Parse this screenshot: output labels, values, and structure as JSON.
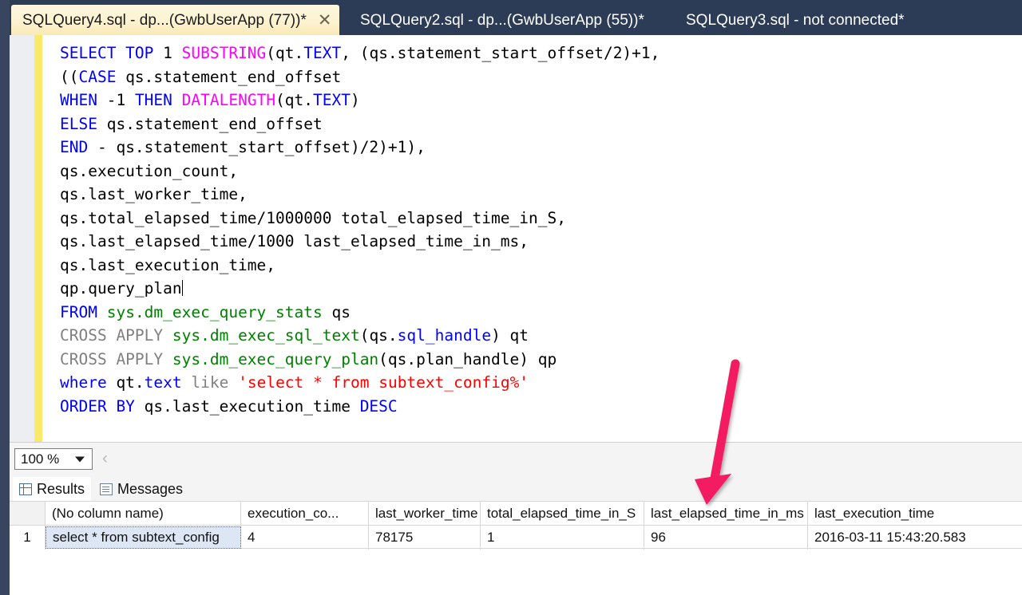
{
  "tabs": [
    {
      "label": "SQLQuery4.sql - dp...(GwbUserApp (77))*",
      "active": true,
      "close_glyph": "✕"
    },
    {
      "label": "SQLQuery2.sql - dp...(GwbUserApp (55))*",
      "active": false
    },
    {
      "label": "SQLQuery3.sql - not connected*",
      "active": false
    }
  ],
  "editor": {
    "lines": [
      [
        {
          "t": "SELECT TOP ",
          "c": "k"
        },
        {
          "t": "1 ",
          "c": ""
        },
        {
          "t": "SUBSTRING",
          "c": "fn"
        },
        {
          "t": "(qt.",
          "c": ""
        },
        {
          "t": "TEXT",
          "c": "k"
        },
        {
          "t": ", (qs.statement_start_offset/2)+1,",
          "c": ""
        }
      ],
      [
        {
          "t": "((",
          "c": ""
        },
        {
          "t": "CASE",
          "c": "k"
        },
        {
          "t": " qs.statement_end_offset",
          "c": ""
        }
      ],
      [
        {
          "t": "WHEN",
          "c": "k"
        },
        {
          "t": " -1 ",
          "c": ""
        },
        {
          "t": "THEN",
          "c": "k"
        },
        {
          "t": " ",
          "c": ""
        },
        {
          "t": "DATALENGTH",
          "c": "fn"
        },
        {
          "t": "(qt.",
          "c": ""
        },
        {
          "t": "TEXT",
          "c": "k"
        },
        {
          "t": ")",
          "c": ""
        }
      ],
      [
        {
          "t": "ELSE",
          "c": "k"
        },
        {
          "t": " qs.statement_end_offset",
          "c": ""
        }
      ],
      [
        {
          "t": "END",
          "c": "k"
        },
        {
          "t": " - qs.statement_start_offset)/2)+1),",
          "c": ""
        }
      ],
      [
        {
          "t": "qs.execution_count,",
          "c": ""
        }
      ],
      [
        {
          "t": "qs.last_worker_time,",
          "c": ""
        }
      ],
      [
        {
          "t": "qs.total_elapsed_time/1000000 total_elapsed_time_in_S,",
          "c": ""
        }
      ],
      [
        {
          "t": "qs.last_elapsed_time/1000 last_elapsed_time_in_ms,",
          "c": ""
        }
      ],
      [
        {
          "t": "qs.last_execution_time,",
          "c": ""
        }
      ],
      [
        {
          "t": "qp.query_plan",
          "c": "",
          "caret": true
        }
      ],
      [
        {
          "t": "FROM",
          "c": "k"
        },
        {
          "t": " ",
          "c": ""
        },
        {
          "t": "sys.dm_exec_query_stats",
          "c": "gn"
        },
        {
          "t": " qs",
          "c": ""
        }
      ],
      [
        {
          "t": "CROSS APPLY",
          "c": "g"
        },
        {
          "t": " ",
          "c": ""
        },
        {
          "t": "sys.dm_exec_sql_text",
          "c": "gn"
        },
        {
          "t": "(qs.",
          "c": ""
        },
        {
          "t": "sql_handle",
          "c": "k"
        },
        {
          "t": ") qt",
          "c": ""
        }
      ],
      [
        {
          "t": "CROSS APPLY",
          "c": "g"
        },
        {
          "t": " ",
          "c": ""
        },
        {
          "t": "sys.dm_exec_query_plan",
          "c": "gn"
        },
        {
          "t": "(qs.plan_handle) qp",
          "c": ""
        }
      ],
      [
        {
          "t": "where",
          "c": "k"
        },
        {
          "t": " qt.",
          "c": ""
        },
        {
          "t": "text",
          "c": "k"
        },
        {
          "t": " ",
          "c": ""
        },
        {
          "t": "like",
          "c": "g"
        },
        {
          "t": " ",
          "c": ""
        },
        {
          "t": "'select * from subtext_config%'",
          "c": "s"
        }
      ],
      [
        {
          "t": "ORDER BY",
          "c": "k"
        },
        {
          "t": " qs.last_execution_time ",
          "c": ""
        },
        {
          "t": "DESC",
          "c": "k"
        }
      ]
    ]
  },
  "zoombar": {
    "zoom_value": "100 %",
    "splitter_chevron": "‹"
  },
  "results_tabs": [
    {
      "label": "Results",
      "icon": "grid-icon",
      "selected": true
    },
    {
      "label": "Messages",
      "icon": "messages-icon",
      "selected": false
    }
  ],
  "grid": {
    "row_number_header": "",
    "columns": [
      "(No column name)",
      "execution_co...",
      "last_worker_time",
      "total_elapsed_time_in_S",
      "last_elapsed_time_in_ms",
      "last_execution_time"
    ],
    "rows": [
      {
        "number": "1",
        "cells": [
          "select * from subtext_config",
          "4",
          "78175",
          "1",
          "96",
          "2016-03-11 15:43:20.583"
        ]
      }
    ]
  },
  "annotation": {
    "arrow_color": "#f31b63",
    "points_at_column": "last_elapsed_time_in_ms"
  },
  "colors": {
    "tabstrip_bg": "#2d3c56",
    "active_tab_bg": "#fdf3d2",
    "change_bar": "#fbe96b",
    "keyword": "#0000ff",
    "function": "#ff00ff",
    "schema_object": "#008000",
    "string": "#ff0000",
    "operator_gray": "#808080",
    "selected_cell": "#dce6f4"
  }
}
